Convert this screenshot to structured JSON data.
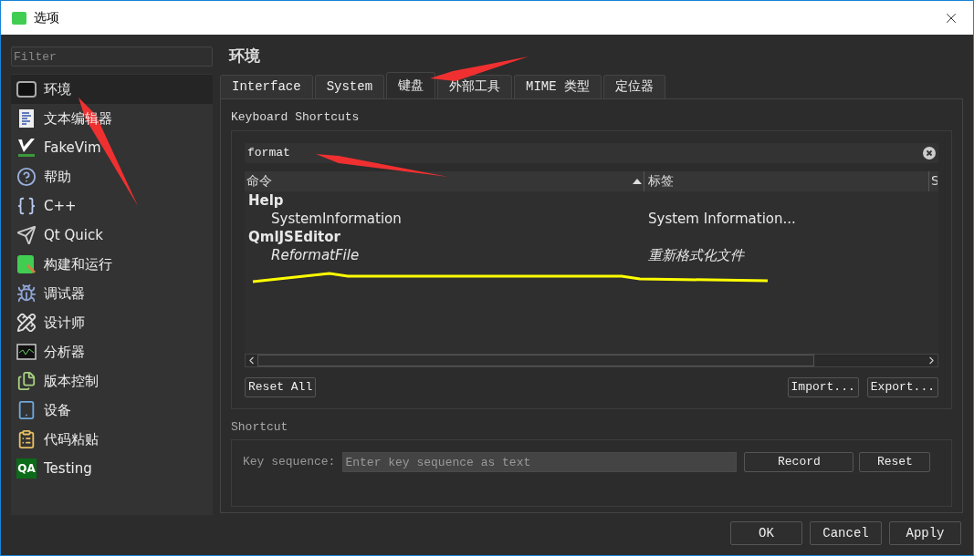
{
  "window": {
    "title": "选项"
  },
  "sidebar": {
    "filter_placeholder": "Filter",
    "items": [
      {
        "label": "环境",
        "selected": true
      },
      {
        "label": "文本编辑器",
        "selected": false
      },
      {
        "label": "FakeVim",
        "selected": false
      },
      {
        "label": "帮助",
        "selected": false
      },
      {
        "label": "C++",
        "selected": false
      },
      {
        "label": "Qt Quick",
        "selected": false
      },
      {
        "label": "构建和运行",
        "selected": false
      },
      {
        "label": "调试器",
        "selected": false
      },
      {
        "label": "设计师",
        "selected": false
      },
      {
        "label": "分析器",
        "selected": false
      },
      {
        "label": "版本控制",
        "selected": false
      },
      {
        "label": "设备",
        "selected": false
      },
      {
        "label": "代码粘贴",
        "selected": false
      },
      {
        "label": "Testing",
        "selected": false,
        "icon_text": "QA"
      }
    ]
  },
  "page_title": "环境",
  "tabs": [
    {
      "label": "Interface",
      "selected": false
    },
    {
      "label": "System",
      "selected": false
    },
    {
      "label": "键盘",
      "selected": true
    },
    {
      "label": "外部工具",
      "selected": false
    },
    {
      "label": "MIME 类型",
      "selected": false
    },
    {
      "label": "定位器",
      "selected": false
    }
  ],
  "shortcuts": {
    "title": "Keyboard Shortcuts",
    "search": "format",
    "columns": [
      "命令",
      "标签",
      "S"
    ],
    "groups": [
      {
        "name": "Help",
        "children": [
          {
            "command": "SystemInformation",
            "label": "System Information...",
            "modified": false
          }
        ]
      },
      {
        "name": "QmlJSEditor",
        "children": [
          {
            "command": "ReformatFile",
            "label": "重新格式化文件",
            "modified": true
          }
        ]
      }
    ],
    "buttons_left": [
      "Reset All"
    ],
    "buttons_right": [
      "Import...",
      "Export..."
    ]
  },
  "shortcut": {
    "title": "Shortcut",
    "key_label": "Key sequence:",
    "placeholder": "Enter key sequence as text",
    "buttons": [
      "Record",
      "Reset"
    ]
  },
  "dialog_buttons": [
    "OK",
    "Cancel",
    "Apply"
  ]
}
